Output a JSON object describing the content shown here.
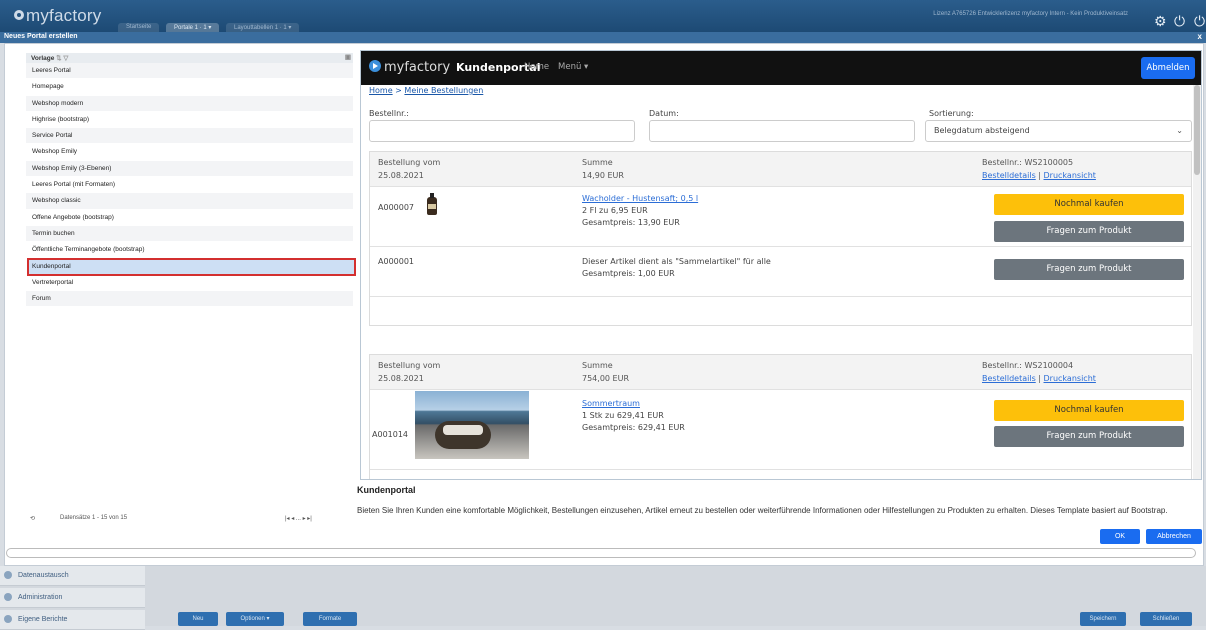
{
  "app": {
    "logo": "myfactory",
    "tabs": [
      "Startseite",
      "Portale 1 · 1 ▾",
      "Layouttabellen 1 · 1 ▾"
    ],
    "license": "Lizenz A765726 Entwicklerlizenz myfactory Intern - Kein Produktiveinsatz"
  },
  "dialog": {
    "title": "Neues Portal erstellen",
    "close": "x"
  },
  "list": {
    "header": "Vorlage",
    "items": [
      "Leeres Portal",
      "Homepage",
      "Webshop modern",
      "Highrise (bootstrap)",
      "Service Portal",
      "Webshop Emily",
      "Webshop Emily (3-Ebenen)",
      "Leeres Portal (mit Formaten)",
      "Webshop classic",
      "Offene Angebote (bootstrap)",
      "Termin buchen",
      "Öffentliche Terminangebote (bootstrap)",
      "Kundenportal",
      "Vertreterportal",
      "Forum"
    ],
    "selected": "Kundenportal",
    "pager": "Datensätze 1 - 15 von 15",
    "pager_nav": "|◂  ◂  ...  ▸  ▸|"
  },
  "preview": {
    "brand": "myfactory",
    "title": "Kundenportal",
    "nav": [
      "Home",
      "Menü ▾"
    ],
    "logout": "Abmelden",
    "breadcrumb": [
      "Home",
      "Meine Bestellungen"
    ],
    "crumb_sep": " > ",
    "filters": {
      "order_label": "Bestellnr.:",
      "date_label": "Datum:",
      "sort_label": "Sortierung:",
      "sort_value": "Belegdatum absteigend"
    },
    "orders": [
      {
        "date_label": "Bestellung vom",
        "date": "25.08.2021",
        "sum_label": "Summe",
        "sum": "14,90 EUR",
        "number": "Bestellnr.: WS2100005",
        "details": "Bestelldetails",
        "sep": " | ",
        "print": "Druckansicht",
        "items": [
          {
            "code": "A000007",
            "name": "Wacholder - Hustensaft; 0,5 l",
            "qty": "2 Fl zu 6,95 EUR",
            "total": "Gesamtpreis: 13,90 EUR",
            "buy": "Nochmal kaufen",
            "ask": "Fragen zum Produkt"
          },
          {
            "code": "A000001",
            "name": "Dieser Artikel dient als \"Sammelartikel\" für alle",
            "total": "Gesamtpreis: 1,00 EUR",
            "ask": "Fragen zum Produkt"
          }
        ]
      },
      {
        "date_label": "Bestellung vom",
        "date": "25.08.2021",
        "sum_label": "Summe",
        "sum": "754,00 EUR",
        "number": "Bestellnr.: WS2100004",
        "details": "Bestelldetails",
        "sep": " | ",
        "print": "Druckansicht",
        "items": [
          {
            "code": "A001014",
            "name": "Sommertraum",
            "qty": "1 Stk zu 629,41 EUR",
            "total": "Gesamtpreis: 629,41 EUR",
            "buy": "Nochmal kaufen",
            "ask": "Fragen zum Produkt"
          }
        ]
      }
    ]
  },
  "description": {
    "title": "Kundenportal",
    "text": "Bieten Sie Ihren Kunden eine komfortable Möglichkeit, Bestellungen einzusehen, Artikel erneut zu bestellen oder weiterführende Informationen oder Hilfestellungen zu Produkten zu erhalten. Dieses Template basiert auf Bootstrap."
  },
  "buttons": {
    "ok": "OK",
    "cancel": "Abbrechen"
  },
  "sidebar": [
    "Datenaustausch",
    "Administration",
    "Eigene Berichte"
  ],
  "footer": {
    "new": "Neu",
    "options": "Optionen ▾",
    "formats": "Formate",
    "save": "Speichern",
    "close": "Schließen"
  }
}
